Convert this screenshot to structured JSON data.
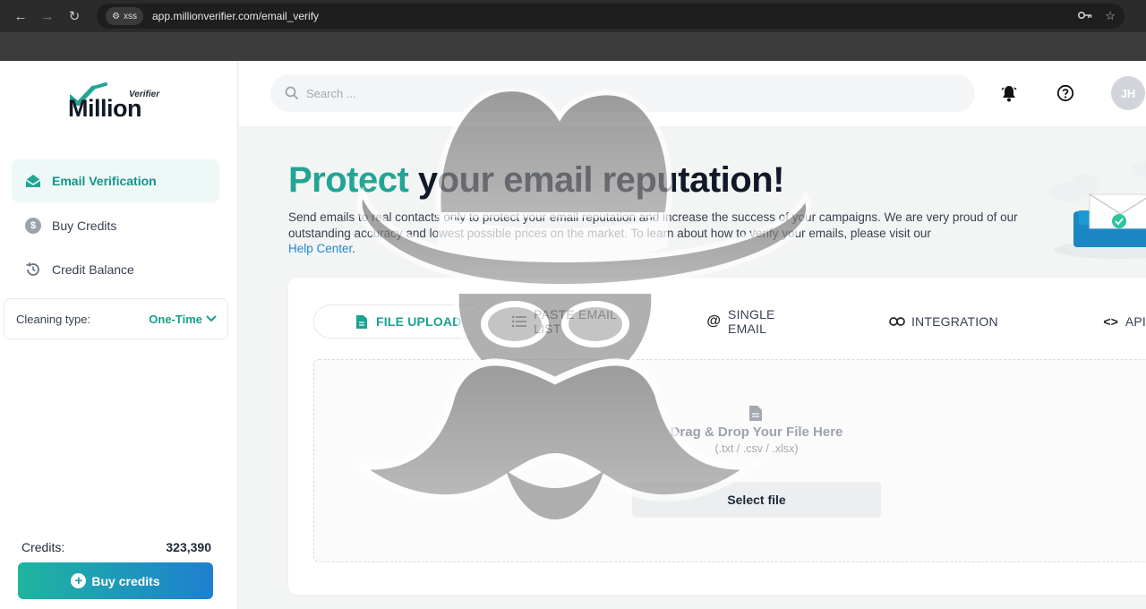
{
  "browser": {
    "site_chip": "xss",
    "url": "app.millionverifier.com/email_verify"
  },
  "logo": {
    "word": "Million",
    "tag": "Verifier"
  },
  "sidebar": {
    "items": [
      {
        "label": "Email Verification",
        "icon": "envelope-icon",
        "active": true
      },
      {
        "label": "Buy Credits",
        "icon": "dollar-icon",
        "active": false
      },
      {
        "label": "Credit Balance",
        "icon": "history-icon",
        "active": false
      }
    ],
    "cleaning_label": "Cleaning type:",
    "cleaning_value": "One-Time",
    "credits_label": "Credits:",
    "credits_value": "323,390",
    "buy_button": "Buy credits"
  },
  "header": {
    "search_placeholder": "Search ...",
    "avatar_initials": "JH"
  },
  "main": {
    "headline_accent": "Protect",
    "headline_rest": " your email reputation!",
    "description": "Send emails to real contacts only to protect your email reputation and increase the success of your campaigns. We are very proud of our outstanding accuracy and lowest possible prices on the market. To learn about how to verify your emails, please visit our",
    "help_link": "Help Center",
    "help_after": ".",
    "tabs": [
      {
        "label": "FILE UPLOAD",
        "icon": "file-icon",
        "active": true
      },
      {
        "label": "PASTE EMAIL LIST",
        "icon": "list-icon",
        "active": false
      },
      {
        "label": "SINGLE EMAIL",
        "icon": "at-icon",
        "active": false
      },
      {
        "label": "INTEGRATION",
        "icon": "link-icon",
        "active": false
      },
      {
        "label": "API",
        "icon": "code-icon",
        "active": false
      }
    ],
    "dropzone": {
      "title": "Drag & Drop Your File Here",
      "formats": "(.txt / .csv / .xlsx)",
      "button": "Select file"
    }
  },
  "colors": {
    "accent": "#22a595",
    "link": "#1f8acf",
    "button_gradient_start": "#1fb59f",
    "button_gradient_end": "#1e7fd1"
  }
}
